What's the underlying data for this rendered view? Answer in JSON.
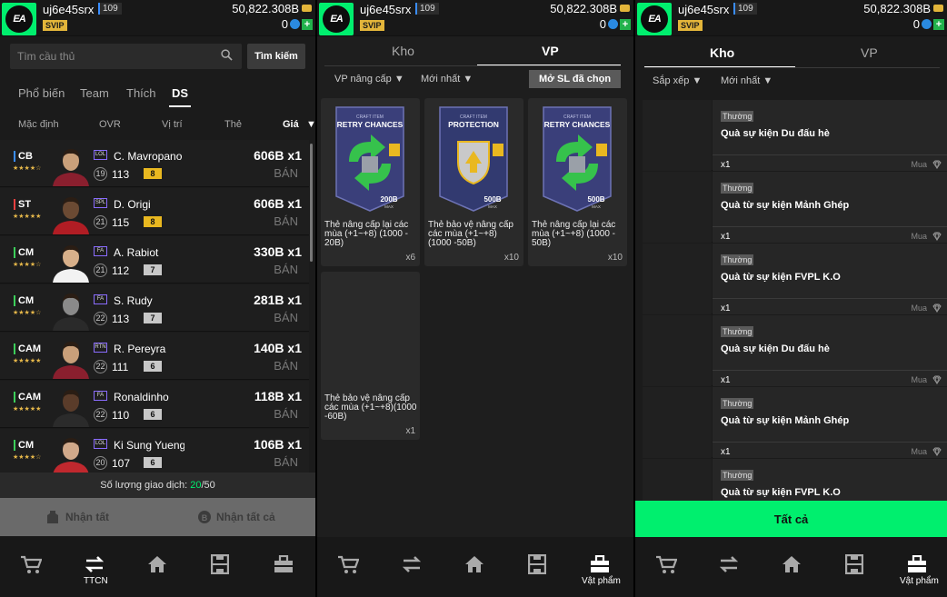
{
  "header": {
    "username": "uj6e45srx",
    "level": "109",
    "vip": "SVIP",
    "coins": "50,822.308B",
    "bc": "0"
  },
  "p1": {
    "search_placeholder": "Tìm cầu thủ",
    "search_button": "Tìm kiếm",
    "tabs": [
      "Phổ biến",
      "Team",
      "Thích",
      "DS"
    ],
    "columns": [
      "Mặc định",
      "OVR",
      "Vị trí",
      "Thẻ",
      "Giá"
    ],
    "players": [
      {
        "pos": "CB",
        "pos_color": "#3a8dff",
        "stars": "★★★★☆",
        "season": "LOL",
        "name": "C. Mavropano",
        "lvl": "19",
        "ovr": "113",
        "boost": "8",
        "boost_color": "#e9b820",
        "price": "606B x1",
        "action": "BÁN"
      },
      {
        "pos": "ST",
        "pos_color": "#e84040",
        "stars": "★★★★★",
        "season": "SPL",
        "name": "D. Origi",
        "lvl": "21",
        "ovr": "115",
        "boost": "8",
        "boost_color": "#e9b820",
        "price": "606B x1",
        "action": "BÁN"
      },
      {
        "pos": "CM",
        "pos_color": "#3ccf5a",
        "stars": "★★★★☆",
        "season": "FA",
        "name": "A. Rabiot",
        "lvl": "21",
        "ovr": "112",
        "boost": "7",
        "boost_color": "#c8c8c8",
        "price": "330B x1",
        "action": "BÁN"
      },
      {
        "pos": "CM",
        "pos_color": "#3ccf5a",
        "stars": "★★★★☆",
        "season": "FA",
        "name": "S. Rudy",
        "lvl": "22",
        "ovr": "113",
        "boost": "7",
        "boost_color": "#c8c8c8",
        "price": "281B x1",
        "action": "BÁN"
      },
      {
        "pos": "CAM",
        "pos_color": "#3ccf5a",
        "stars": "★★★★★",
        "season": "RTN",
        "name": "R. Pereyra",
        "lvl": "22",
        "ovr": "111",
        "boost": "6",
        "boost_color": "#c8c8c8",
        "price": "140B x1",
        "action": "BÁN"
      },
      {
        "pos": "CAM",
        "pos_color": "#3ccf5a",
        "stars": "★★★★★",
        "season": "FA",
        "name": "Ronaldinho",
        "lvl": "22",
        "ovr": "110",
        "boost": "6",
        "boost_color": "#c8c8c8",
        "price": "118B x1",
        "action": "BÁN"
      },
      {
        "pos": "CM",
        "pos_color": "#3ccf5a",
        "stars": "★★★★☆",
        "season": "LOL",
        "name": "Ki Sung Yueng",
        "lvl": "20",
        "ovr": "107",
        "boost": "6",
        "boost_color": "#c8c8c8",
        "price": "106B x1",
        "action": "BÁN"
      }
    ],
    "trade_label": "Số lượng giao dịch: ",
    "trade_used": "20",
    "trade_total": "/50",
    "receive": "Nhận tất",
    "receive_all": "Nhận tất cả",
    "nav_active_label": "TTCN"
  },
  "p2": {
    "tabs": [
      "Kho",
      "VP"
    ],
    "filter1": "VP nâng cấp",
    "filter2": "Mới nhất",
    "open_button": "Mở SL đã chọn",
    "cards": [
      {
        "art_label": "RETRY CHANCES",
        "craft": "CRAFT ITEM",
        "value": "200B",
        "max": "MAX",
        "title": "Thẻ nâng cấp lại các mùa (+1~+8) (1000 - 20B)",
        "qty": "x6",
        "color": "#3a3f7a"
      },
      {
        "art_label": "PROTECTION",
        "craft": "CRAFT ITEM",
        "value": "500B",
        "max": "MAX",
        "title": "Thẻ bảo vệ nâng cấp các mùa (+1~+8) (1000 -50B)",
        "qty": "x10",
        "color": "#323a70"
      },
      {
        "art_label": "RETRY CHANCES",
        "craft": "CRAFT ITEM",
        "value": "500B",
        "max": "MAX",
        "title": "Thẻ nâng cấp lại các mùa (+1~+8) (1000 - 50B)",
        "qty": "x10",
        "color": "#3a3f7a"
      },
      {
        "title": "Thẻ bảo vệ nâng cấp các mùa (+1~+8)(1000 -60B)",
        "qty": "x1"
      }
    ],
    "nav_active_label": "Vật phẩm"
  },
  "p3": {
    "tabs": [
      "Kho",
      "VP"
    ],
    "filter1": "Sắp xếp",
    "filter2": "Mới nhất",
    "items": [
      {
        "tag": "Thường",
        "name": "Quà sự kiện Du đấu hè",
        "qty": "x1",
        "buy": "Mua"
      },
      {
        "tag": "Thường",
        "name": "Quà từ sự kiện Mảnh Ghép",
        "qty": "x1",
        "buy": "Mua"
      },
      {
        "tag": "Thường",
        "name": "Quà từ sự kiện FVPL K.O",
        "qty": "x1",
        "buy": "Mua"
      },
      {
        "tag": "Thường",
        "name": "Quà sự kiện Du đấu hè",
        "qty": "x1",
        "buy": "Mua"
      },
      {
        "tag": "Thường",
        "name": "Quà từ sự kiện Mảnh Ghép",
        "qty": "x1",
        "buy": "Mua"
      },
      {
        "tag": "Thường",
        "name": "Quà từ sự kiện FVPL K.O",
        "qty": "x1",
        "buy": "Mua"
      }
    ],
    "all_button": "Tất cả",
    "nav_active_label": "Vật phẩm"
  }
}
